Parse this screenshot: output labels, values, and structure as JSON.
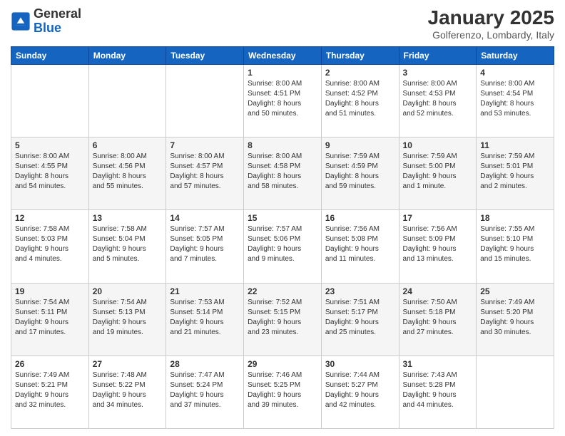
{
  "logo": {
    "text_general": "General",
    "text_blue": "Blue"
  },
  "header": {
    "month": "January 2025",
    "location": "Golferenzo, Lombardy, Italy"
  },
  "weekdays": [
    "Sunday",
    "Monday",
    "Tuesday",
    "Wednesday",
    "Thursday",
    "Friday",
    "Saturday"
  ],
  "weeks": [
    [
      {
        "day": "",
        "info": ""
      },
      {
        "day": "",
        "info": ""
      },
      {
        "day": "",
        "info": ""
      },
      {
        "day": "1",
        "info": "Sunrise: 8:00 AM\nSunset: 4:51 PM\nDaylight: 8 hours\nand 50 minutes."
      },
      {
        "day": "2",
        "info": "Sunrise: 8:00 AM\nSunset: 4:52 PM\nDaylight: 8 hours\nand 51 minutes."
      },
      {
        "day": "3",
        "info": "Sunrise: 8:00 AM\nSunset: 4:53 PM\nDaylight: 8 hours\nand 52 minutes."
      },
      {
        "day": "4",
        "info": "Sunrise: 8:00 AM\nSunset: 4:54 PM\nDaylight: 8 hours\nand 53 minutes."
      }
    ],
    [
      {
        "day": "5",
        "info": "Sunrise: 8:00 AM\nSunset: 4:55 PM\nDaylight: 8 hours\nand 54 minutes."
      },
      {
        "day": "6",
        "info": "Sunrise: 8:00 AM\nSunset: 4:56 PM\nDaylight: 8 hours\nand 55 minutes."
      },
      {
        "day": "7",
        "info": "Sunrise: 8:00 AM\nSunset: 4:57 PM\nDaylight: 8 hours\nand 57 minutes."
      },
      {
        "day": "8",
        "info": "Sunrise: 8:00 AM\nSunset: 4:58 PM\nDaylight: 8 hours\nand 58 minutes."
      },
      {
        "day": "9",
        "info": "Sunrise: 7:59 AM\nSunset: 4:59 PM\nDaylight: 8 hours\nand 59 minutes."
      },
      {
        "day": "10",
        "info": "Sunrise: 7:59 AM\nSunset: 5:00 PM\nDaylight: 9 hours\nand 1 minute."
      },
      {
        "day": "11",
        "info": "Sunrise: 7:59 AM\nSunset: 5:01 PM\nDaylight: 9 hours\nand 2 minutes."
      }
    ],
    [
      {
        "day": "12",
        "info": "Sunrise: 7:58 AM\nSunset: 5:03 PM\nDaylight: 9 hours\nand 4 minutes."
      },
      {
        "day": "13",
        "info": "Sunrise: 7:58 AM\nSunset: 5:04 PM\nDaylight: 9 hours\nand 5 minutes."
      },
      {
        "day": "14",
        "info": "Sunrise: 7:57 AM\nSunset: 5:05 PM\nDaylight: 9 hours\nand 7 minutes."
      },
      {
        "day": "15",
        "info": "Sunrise: 7:57 AM\nSunset: 5:06 PM\nDaylight: 9 hours\nand 9 minutes."
      },
      {
        "day": "16",
        "info": "Sunrise: 7:56 AM\nSunset: 5:08 PM\nDaylight: 9 hours\nand 11 minutes."
      },
      {
        "day": "17",
        "info": "Sunrise: 7:56 AM\nSunset: 5:09 PM\nDaylight: 9 hours\nand 13 minutes."
      },
      {
        "day": "18",
        "info": "Sunrise: 7:55 AM\nSunset: 5:10 PM\nDaylight: 9 hours\nand 15 minutes."
      }
    ],
    [
      {
        "day": "19",
        "info": "Sunrise: 7:54 AM\nSunset: 5:11 PM\nDaylight: 9 hours\nand 17 minutes."
      },
      {
        "day": "20",
        "info": "Sunrise: 7:54 AM\nSunset: 5:13 PM\nDaylight: 9 hours\nand 19 minutes."
      },
      {
        "day": "21",
        "info": "Sunrise: 7:53 AM\nSunset: 5:14 PM\nDaylight: 9 hours\nand 21 minutes."
      },
      {
        "day": "22",
        "info": "Sunrise: 7:52 AM\nSunset: 5:15 PM\nDaylight: 9 hours\nand 23 minutes."
      },
      {
        "day": "23",
        "info": "Sunrise: 7:51 AM\nSunset: 5:17 PM\nDaylight: 9 hours\nand 25 minutes."
      },
      {
        "day": "24",
        "info": "Sunrise: 7:50 AM\nSunset: 5:18 PM\nDaylight: 9 hours\nand 27 minutes."
      },
      {
        "day": "25",
        "info": "Sunrise: 7:49 AM\nSunset: 5:20 PM\nDaylight: 9 hours\nand 30 minutes."
      }
    ],
    [
      {
        "day": "26",
        "info": "Sunrise: 7:49 AM\nSunset: 5:21 PM\nDaylight: 9 hours\nand 32 minutes."
      },
      {
        "day": "27",
        "info": "Sunrise: 7:48 AM\nSunset: 5:22 PM\nDaylight: 9 hours\nand 34 minutes."
      },
      {
        "day": "28",
        "info": "Sunrise: 7:47 AM\nSunset: 5:24 PM\nDaylight: 9 hours\nand 37 minutes."
      },
      {
        "day": "29",
        "info": "Sunrise: 7:46 AM\nSunset: 5:25 PM\nDaylight: 9 hours\nand 39 minutes."
      },
      {
        "day": "30",
        "info": "Sunrise: 7:44 AM\nSunset: 5:27 PM\nDaylight: 9 hours\nand 42 minutes."
      },
      {
        "day": "31",
        "info": "Sunrise: 7:43 AM\nSunset: 5:28 PM\nDaylight: 9 hours\nand 44 minutes."
      },
      {
        "day": "",
        "info": ""
      }
    ]
  ]
}
